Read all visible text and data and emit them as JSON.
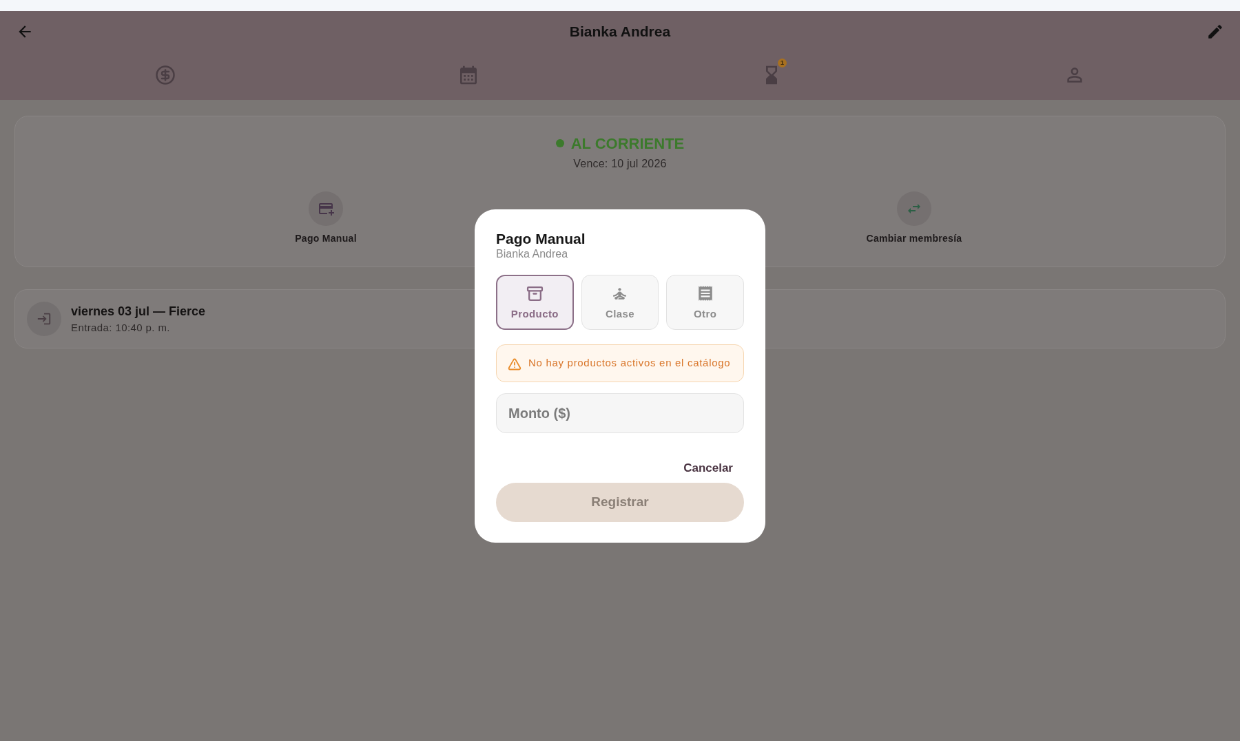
{
  "header": {
    "title": "Bianka Andrea"
  },
  "tabs": [
    {
      "kind": "payments"
    },
    {
      "kind": "calendar"
    },
    {
      "kind": "timer",
      "badge": "1"
    },
    {
      "kind": "profile"
    }
  ],
  "status": {
    "label": "AL CORRIENTE",
    "expires": "Vence: 10 jul 2026"
  },
  "actions": [
    {
      "kind": "payment",
      "label": "Pago Manual"
    },
    {
      "kind": "swap",
      "label": "Cambiar membresía"
    }
  ],
  "visits": [
    {
      "title": "viernes 03 jul — Fierce",
      "subtitle": "Entrada: 10:40 p. m."
    }
  ],
  "dialog": {
    "title": "Pago Manual",
    "subtitle": "Bianka Andrea",
    "types": [
      {
        "kind": "product",
        "label": "Producto",
        "selected": true
      },
      {
        "kind": "class",
        "label": "Clase",
        "selected": false
      },
      {
        "kind": "other",
        "label": "Otro",
        "selected": false
      }
    ],
    "warning": "No hay productos activos en el catálogo",
    "amount": {
      "placeholder": "Monto ($)"
    },
    "cancel": "Cancelar",
    "submit": {
      "label": "Registrar",
      "disabled": true
    }
  }
}
